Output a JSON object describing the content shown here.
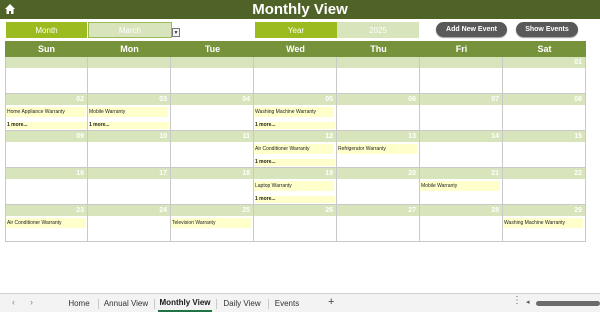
{
  "header": {
    "title": "Monthly View",
    "home_icon": "home-icon"
  },
  "controls": {
    "month_label": "Month",
    "month_value": "March",
    "year_label": "Year",
    "year_value": "2025",
    "add_button": "Add New Event",
    "show_button": "Show Events"
  },
  "calendar": {
    "weekdays": [
      "Sun",
      "Mon",
      "Tue",
      "Wed",
      "Thu",
      "Fri",
      "Sat"
    ],
    "weeks": [
      [
        {
          "day": "",
          "event": "",
          "more": ""
        },
        {
          "day": "",
          "event": "",
          "more": ""
        },
        {
          "day": "",
          "event": "",
          "more": ""
        },
        {
          "day": "",
          "event": "",
          "more": ""
        },
        {
          "day": "",
          "event": "",
          "more": ""
        },
        {
          "day": "",
          "event": "",
          "more": ""
        },
        {
          "day": "01",
          "event": "",
          "more": ""
        }
      ],
      [
        {
          "day": "02",
          "event": "Home Appliance Warranty",
          "more": "1 more..."
        },
        {
          "day": "03",
          "event": "Mobile Warranty",
          "more": "1 more..."
        },
        {
          "day": "04",
          "event": "",
          "more": ""
        },
        {
          "day": "05",
          "event": "Washing Machine Warranty",
          "more": "1 more..."
        },
        {
          "day": "06",
          "event": "",
          "more": ""
        },
        {
          "day": "07",
          "event": "",
          "more": ""
        },
        {
          "day": "08",
          "event": "",
          "more": ""
        }
      ],
      [
        {
          "day": "09",
          "event": "",
          "more": ""
        },
        {
          "day": "10",
          "event": "",
          "more": ""
        },
        {
          "day": "11",
          "event": "",
          "more": ""
        },
        {
          "day": "12",
          "event": "Air Conditioner Warranty",
          "more": "1 more..."
        },
        {
          "day": "13",
          "event": "Refrigerator Warranty",
          "more": ""
        },
        {
          "day": "14",
          "event": "",
          "more": ""
        },
        {
          "day": "15",
          "event": "",
          "more": ""
        }
      ],
      [
        {
          "day": "16",
          "event": "",
          "more": ""
        },
        {
          "day": "17",
          "event": "",
          "more": ""
        },
        {
          "day": "18",
          "event": "",
          "more": ""
        },
        {
          "day": "19",
          "event": "Laptop Warranty",
          "more": "1 more..."
        },
        {
          "day": "20",
          "event": "",
          "more": ""
        },
        {
          "day": "21",
          "event": "Mobile Warranty",
          "more": ""
        },
        {
          "day": "22",
          "event": "",
          "more": ""
        }
      ],
      [
        {
          "day": "23",
          "event": "Air Conditioner Warranty",
          "more": ""
        },
        {
          "day": "24",
          "event": "",
          "more": ""
        },
        {
          "day": "25",
          "event": "Television Warranty",
          "more": ""
        },
        {
          "day": "26",
          "event": "",
          "more": ""
        },
        {
          "day": "27",
          "event": "",
          "more": ""
        },
        {
          "day": "28",
          "event": "",
          "more": ""
        },
        {
          "day": "29",
          "event": "Washing Machine Warranty",
          "more": ""
        }
      ]
    ]
  },
  "sheet_tabs": {
    "tabs": [
      "Home",
      "Annual View",
      "Monthly View",
      "Daily View",
      "Events"
    ],
    "active": "Monthly View"
  },
  "colors": {
    "title_bar": "#4f6228",
    "header_row": "#76933c",
    "day_number_band": "#d8e4bc",
    "event_fill": "#ffffcc",
    "control_label": "#9bbb1f",
    "button": "#595959"
  }
}
